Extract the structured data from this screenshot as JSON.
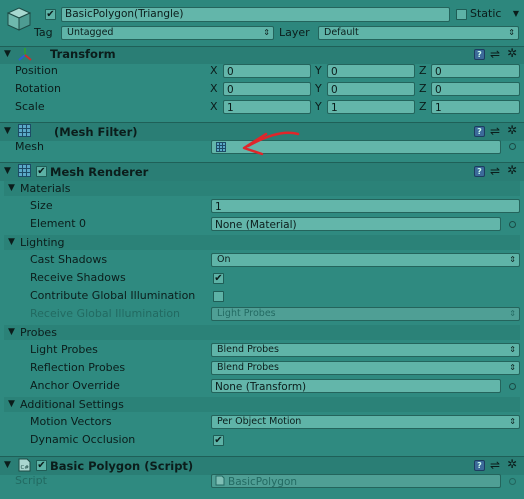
{
  "header": {
    "object_name": "BasicPolygon(Triangle)",
    "active": true,
    "static_label": "Static",
    "static_checked": false,
    "tag_label": "Tag",
    "tag_value": "Untagged",
    "layer_label": "Layer",
    "layer_value": "Default"
  },
  "transform": {
    "title": "Transform",
    "rows": [
      {
        "label": "Position",
        "x": "0",
        "y": "0",
        "z": "0"
      },
      {
        "label": "Rotation",
        "x": "0",
        "y": "0",
        "z": "0"
      },
      {
        "label": "Scale",
        "x": "1",
        "y": "1",
        "z": "1"
      }
    ],
    "axis_x": "X",
    "axis_y": "Y",
    "axis_z": "Z"
  },
  "mesh_filter": {
    "title": "(Mesh Filter)",
    "mesh_label": "Mesh",
    "mesh_value": ""
  },
  "mesh_renderer": {
    "title": "Mesh Renderer",
    "enabled": true,
    "materials": {
      "header": "Materials",
      "size_label": "Size",
      "size_value": "1",
      "element_label": "Element 0",
      "element_value": "None (Material)"
    },
    "lighting": {
      "header": "Lighting",
      "cast_label": "Cast Shadows",
      "cast_value": "On",
      "receive_label": "Receive Shadows",
      "receive_checked": true,
      "gi_label": "Contribute Global Illumination",
      "gi_checked": false,
      "rgi_label": "Receive Global Illumination",
      "rgi_value": "Light Probes"
    },
    "probes": {
      "header": "Probes",
      "light_label": "Light Probes",
      "light_value": "Blend Probes",
      "reflection_label": "Reflection Probes",
      "reflection_value": "Blend Probes",
      "anchor_label": "Anchor Override",
      "anchor_value": "None (Transform)"
    },
    "additional": {
      "header": "Additional Settings",
      "motion_label": "Motion Vectors",
      "motion_value": "Per Object Motion",
      "occlusion_label": "Dynamic Occlusion",
      "occlusion_checked": true
    }
  },
  "script_comp": {
    "title": "Basic Polygon (Script)",
    "enabled": true,
    "script_label": "Script",
    "script_value": "BasicPolygon"
  },
  "icons": {
    "checkmark": "✔",
    "fold_open": "▼",
    "dropdown_arrow": "⇕",
    "gear": "✲",
    "sliders": "⇌",
    "help": "?"
  },
  "colors": {
    "background": "#2f8a80",
    "field": "#63b6aa",
    "header_bar": "#2a7e75",
    "annotation_arrow": "#e0262a"
  }
}
